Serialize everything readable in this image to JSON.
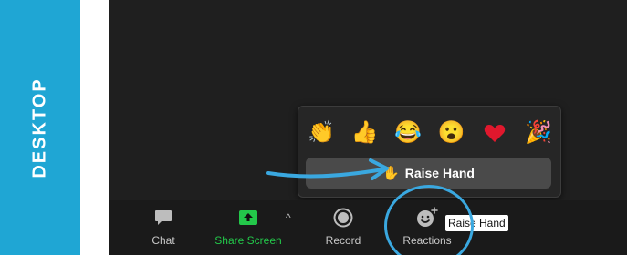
{
  "banner": {
    "label": "DESKTOP",
    "color": "#1fa6d4"
  },
  "reactions_popup": {
    "emojis": [
      {
        "icon": "clapping-hands-icon",
        "glyph": "👏"
      },
      {
        "icon": "thumbs-up-icon",
        "glyph": "👍"
      },
      {
        "icon": "tears-of-joy-icon",
        "glyph": "😂"
      },
      {
        "icon": "surprised-face-icon",
        "glyph": "😮"
      },
      {
        "icon": "red-heart-icon",
        "glyph": "❤"
      },
      {
        "icon": "party-popper-icon",
        "glyph": "🎉"
      }
    ],
    "raise_hand": {
      "icon": "raised-hand-icon",
      "glyph": "✋",
      "label": "Raise Hand"
    }
  },
  "toolbar": {
    "chat": {
      "label": "Chat",
      "icon": "chat-icon"
    },
    "share_screen": {
      "label": "Share Screen",
      "icon": "share-screen-icon",
      "color": "#23c84a"
    },
    "caret": "^",
    "record": {
      "label": "Record",
      "icon": "record-icon"
    },
    "reactions": {
      "label": "Reactions",
      "icon": "reactions-smiley-icon"
    }
  },
  "tooltip": {
    "text": "Raise Hand"
  },
  "annotation": {
    "color": "#3aa8e0"
  }
}
